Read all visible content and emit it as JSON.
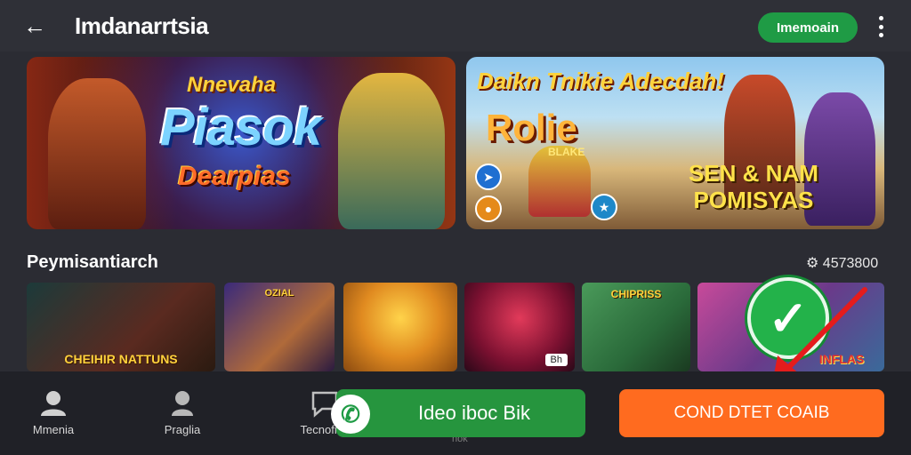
{
  "header": {
    "title": "Imdanarrtsia",
    "pill_label": "Imemoain",
    "back_icon": "arrow-left-icon",
    "menu_icon": "more-vertical-icon"
  },
  "banners": [
    {
      "sub_title": "Nnevaha",
      "main_title": "Piasok",
      "sub_title_2": "Dearpias"
    },
    {
      "top_text": "Daikn Tnikie Adecdah!",
      "main_title": "Rolie",
      "small_text": "BLAKE",
      "bottom_text_1": "SEN & NAM",
      "bottom_text_2": "POMISYAS"
    }
  ],
  "section": {
    "title": "Peymisantiarch",
    "count": "4573800"
  },
  "thumbnails": [
    {
      "label": "CHEIHIR NATTUNS"
    },
    {
      "label": "OZIAL"
    },
    {
      "label": ""
    },
    {
      "label": "",
      "tag": "Bh"
    },
    {
      "label": "CHIPRISS"
    },
    {
      "label": "INFLAS"
    }
  ],
  "bottom_nav": [
    {
      "label": "Mmenia",
      "icon": "account-icon"
    },
    {
      "label": "Praglia",
      "icon": "user-icon"
    },
    {
      "label": "Tecnofika",
      "icon": "chat-icon"
    }
  ],
  "nav_sub": "hok",
  "buttons": {
    "green_label": "Ideo iboc Bik",
    "orange_label": "COND DTET COAIB"
  },
  "colors": {
    "accent_green": "#26953e",
    "accent_orange": "#ff6b1f",
    "background": "#2b2c33"
  }
}
